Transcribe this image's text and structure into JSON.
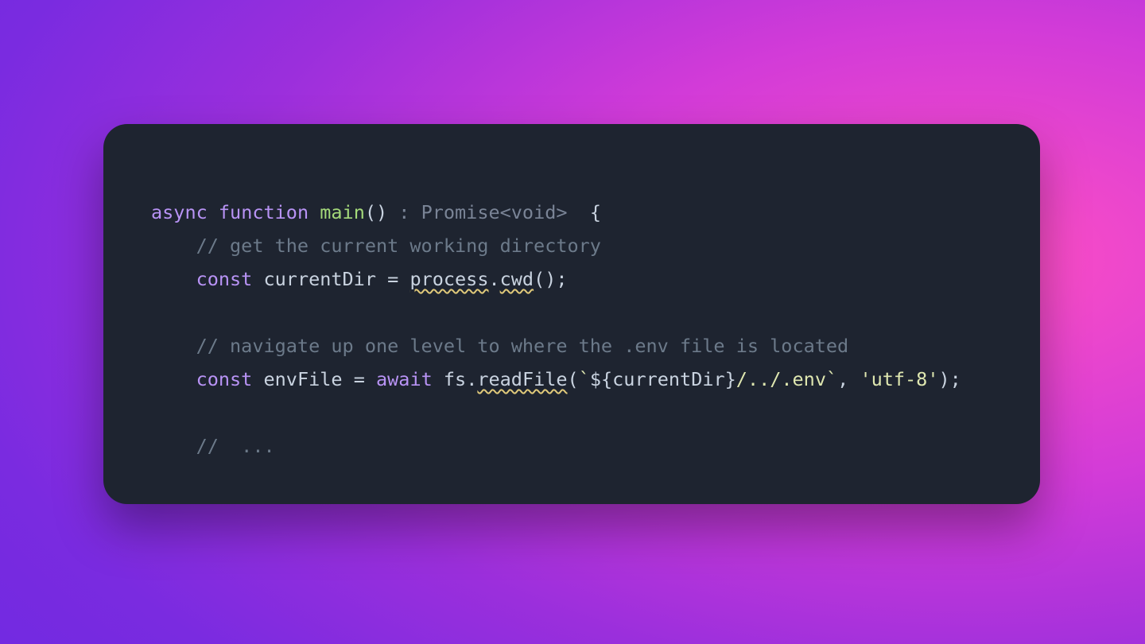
{
  "code": {
    "line1": {
      "async": "async",
      "function": "function",
      "name": "main",
      "parens": "()",
      "hint_prefix": " : ",
      "hint_type": "Promise<void>",
      "open_brace": "  {"
    },
    "line2_comment": "// get the current working directory",
    "line3": {
      "const": "const",
      "ident": "currentDir",
      "eq": " = ",
      "obj": "process",
      "dot": ".",
      "method": "cwd",
      "call": "();"
    },
    "line4_comment": "// navigate up one level to where the .env file is located",
    "line5": {
      "const": "const",
      "ident": "envFile",
      "eq": " = ",
      "await": "await",
      "sp": " ",
      "obj": "fs",
      "dot": ".",
      "method": "readFile",
      "open": "(",
      "tick_open": "`",
      "tmpl_exp_open": "${",
      "tmpl_exp_ident": "currentDir",
      "tmpl_exp_close": "}",
      "tmpl_rest": "/../.env",
      "tick_close": "`",
      "comma_sp": ", ",
      "arg2": "'utf-8'",
      "close": ");"
    },
    "line7_comment": "//  ..."
  }
}
